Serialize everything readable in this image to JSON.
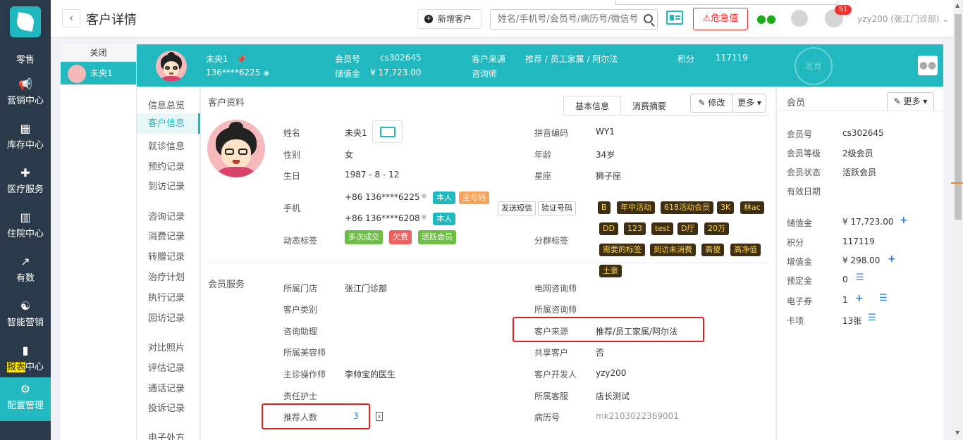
{
  "nav": {
    "items": [
      {
        "label": "零售",
        "icon": "logo-icon"
      },
      {
        "label": "营销中心",
        "icon": "megaphone-icon"
      },
      {
        "label": "库存中心",
        "icon": "grid-icon"
      },
      {
        "label": "医疗服务",
        "icon": "medkit-icon"
      },
      {
        "label": "住院中心",
        "icon": "building-icon"
      },
      {
        "label": "有数",
        "icon": "trend-icon"
      },
      {
        "label": "智能营销",
        "icon": "brain-icon"
      },
      {
        "label_hl": "报表",
        "label_rest": "中心",
        "icon": "barchart-icon"
      },
      {
        "label": "配置管理",
        "icon": "gear-icon"
      }
    ]
  },
  "topbar": {
    "title": "客户详情",
    "add_customer": "新增客户",
    "search_placeholder": "姓名/手机号/会员号/病历号/微信号",
    "danger": "危急值",
    "badge": "51",
    "user": "yzy200 (张江门诊部)"
  },
  "patient_list": {
    "close": "关闭",
    "item": "未央1"
  },
  "header": {
    "name": "未央1",
    "phone": "136****6225",
    "member_no_label": "会员号",
    "member_no": "cs302645",
    "stored_label": "储值金",
    "stored": "¥ 17,723.00",
    "source_label": "客户来源",
    "source": "推荐 / 员工家属 / 阿尔法",
    "consultant_label": "咨询师",
    "points_label": "积分",
    "points": "117119",
    "stamp": "发育"
  },
  "side_menu": [
    "信息总览",
    "客户信息",
    "就诊信息",
    "预约记录",
    "到访记录",
    "咨询记录",
    "消费记录",
    "转赠记录",
    "治疗计划",
    "执行记录",
    "回访记录",
    "对比照片",
    "评估记录",
    "通话记录",
    "投诉记录",
    "电子处方"
  ],
  "main": {
    "section_profile": "客户资料",
    "tab_basic": "基本信息",
    "tab_summary": "消费摘要",
    "edit": "修改",
    "more": "更多",
    "name_label": "姓名",
    "name": "未央1",
    "gender_label": "性别",
    "gender": "女",
    "birth_label": "生日",
    "birth": "1987 - 8 - 12",
    "phone_label": "手机",
    "phone1": "+86  136****6225",
    "phone2": "+86  136****6208",
    "tag_self": "本人",
    "tag_main": "主号码",
    "send_sms": "发送短信",
    "verify": "验证号码",
    "dyn_label": "动态标签",
    "dyn_tags": [
      "多次成交",
      "欠费",
      "活跃会员"
    ],
    "pinyin_label": "拼音编码",
    "pinyin": "WY1",
    "age_label": "年龄",
    "age": "34岁",
    "zodiac_label": "星座",
    "zodiac": "狮子座",
    "group_label": "分群标签",
    "group_tags": [
      "B",
      "年中活动",
      "618活动会员",
      "3K",
      "林ac",
      "DD",
      "123",
      "test",
      "D厅",
      "20万",
      "需要的标签",
      "到访未消费",
      "高傻",
      "高净值",
      "土豪"
    ],
    "member_service": "会员服务",
    "store_label": "所属门店",
    "store": "张江门诊部",
    "ctype_label": "客户类别",
    "assistant_label": "咨询助理",
    "beautician_label": "所属美容师",
    "doctor_label": "主诊操作师",
    "doctor": "李帅宝的医生",
    "nurse_label": "责任护士",
    "referral_label": "推荐人数",
    "referral": "3",
    "tel_consultant_label": "电网咨询师",
    "consultant_label": "所属咨询师",
    "source_label": "客户来源",
    "source": "推荐/员工家属/阿尔法",
    "shared_label": "共享客户",
    "shared": "否",
    "developer_label": "客户开发人",
    "developer": "yzy200",
    "service_label": "所属客服",
    "service": "店长测试",
    "record_label": "病历号",
    "record": "mk2103022369001"
  },
  "right": {
    "title": "会员",
    "more": "更多",
    "member_no_label": "会员号",
    "member_no": "cs302645",
    "level_label": "会员等级",
    "level": "2级会员",
    "status_label": "会员状态",
    "status": "活跃会员",
    "valid_label": "有效日期",
    "stored_label": "储值金",
    "stored": "¥  17,723.00",
    "points_label": "积分",
    "points": "117119",
    "bonus_label": "增值金",
    "bonus": "¥  298.00",
    "deposit_label": "预定金",
    "deposit": "0",
    "coupon_label": "电子券",
    "coupon": "1",
    "card_label": "卡项",
    "card": "13张"
  },
  "colors": {
    "teal": "#21b8bf",
    "nav": "#2b3a4a",
    "red": "#e02020",
    "link": "#2a7ae2"
  }
}
